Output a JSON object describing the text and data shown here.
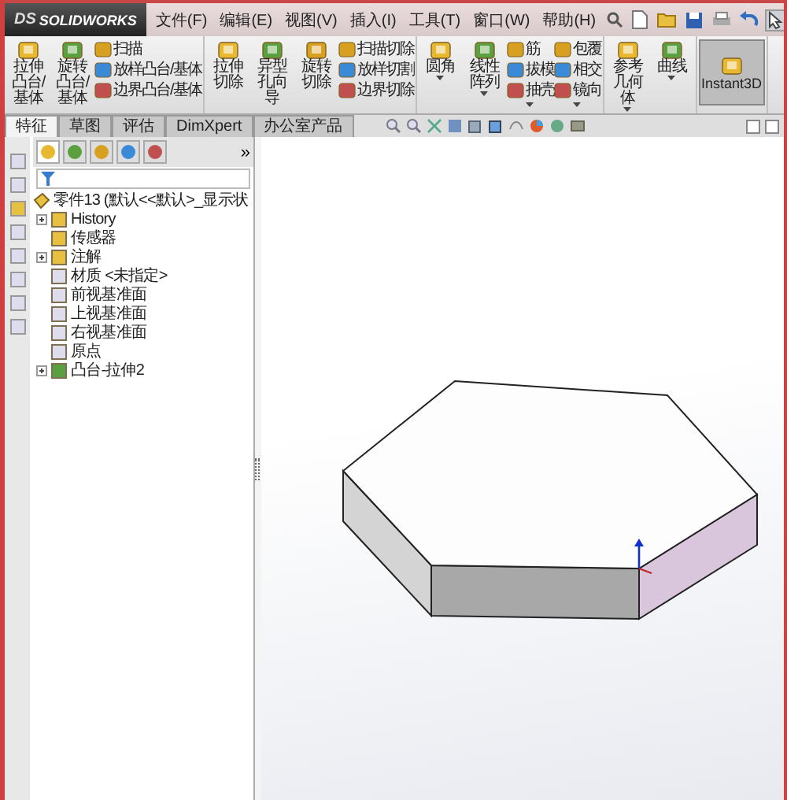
{
  "app": {
    "logo_mark": "DS",
    "logo": "SOLIDWORKS"
  },
  "menu": [
    "文件(F)",
    "编辑(E)",
    "视图(V)",
    "插入(I)",
    "工具(T)",
    "窗口(W)",
    "帮助(H)"
  ],
  "ribbon": {
    "groups": [
      {
        "items": [
          {
            "kind": "large",
            "label": "拉伸凸台/基体",
            "dropdown": false,
            "pressed": false
          },
          {
            "kind": "large",
            "label": "旋转凸台/基体",
            "dropdown": false,
            "pressed": false
          },
          {
            "kind": "stack",
            "labels": [
              "扫描",
              "放样凸台/基体",
              "边界凸台/基体"
            ],
            "dropdown": false
          }
        ]
      },
      {
        "items": [
          {
            "kind": "large",
            "label": "拉伸切除",
            "dropdown": false,
            "pressed": false
          },
          {
            "kind": "large",
            "label": "异型孔向导",
            "dropdown": false,
            "pressed": false
          },
          {
            "kind": "large",
            "label": "旋转切除",
            "dropdown": false,
            "pressed": false
          },
          {
            "kind": "stack",
            "labels": [
              "扫描切除",
              "放样切割",
              "边界切除"
            ],
            "dropdown": false
          }
        ]
      },
      {
        "items": [
          {
            "kind": "large",
            "label": "圆角",
            "dropdown": true,
            "pressed": false
          },
          {
            "kind": "large",
            "label": "线性阵列",
            "dropdown": true,
            "pressed": false
          },
          {
            "kind": "stack",
            "labels": [
              "筋",
              "拔模",
              "抽壳"
            ],
            "dropdown": true
          },
          {
            "kind": "stack",
            "labels": [
              "包覆",
              "相交",
              "镜向"
            ],
            "dropdown": true
          }
        ]
      },
      {
        "items": [
          {
            "kind": "large",
            "label": "参考几何体",
            "dropdown": true,
            "pressed": false
          },
          {
            "kind": "large",
            "label": "曲线",
            "dropdown": true,
            "pressed": false
          }
        ]
      },
      {
        "items": [
          {
            "kind": "large",
            "label": "Instant3D",
            "dropdown": false,
            "pressed": true
          }
        ]
      }
    ]
  },
  "tabs": [
    {
      "label": "特征",
      "selected": true
    },
    {
      "label": "草图",
      "selected": false
    },
    {
      "label": "评估",
      "selected": false
    },
    {
      "label": "DimXpert",
      "selected": false
    },
    {
      "label": "办公室产品",
      "selected": false
    }
  ],
  "panel": {
    "more": "»"
  },
  "tree": [
    {
      "label": "零件13 (默认<<默认>_显示状",
      "expandable": false,
      "children": [
        {
          "label": "History",
          "expandable": true
        },
        {
          "label": "传感器",
          "expandable": false
        },
        {
          "label": "注解",
          "expandable": true
        },
        {
          "label": "材质 <未指定>",
          "expandable": false
        },
        {
          "label": "前视基准面",
          "expandable": false
        },
        {
          "label": "上视基准面",
          "expandable": false
        },
        {
          "label": "右视基准面",
          "expandable": false
        },
        {
          "label": "原点",
          "expandable": false
        },
        {
          "label": "凸台-拉伸2",
          "expandable": true
        }
      ]
    }
  ]
}
